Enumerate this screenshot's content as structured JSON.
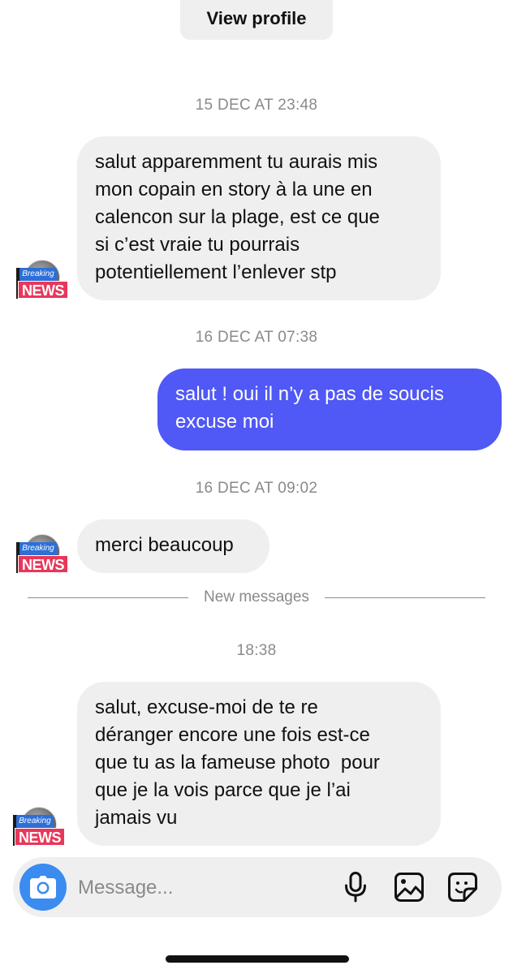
{
  "header": {
    "view_profile_label": "View profile"
  },
  "thread": {
    "timestamps": [
      "15 DEC AT 23:48",
      "16 DEC AT 07:38",
      "16 DEC AT 09:02",
      "18:38"
    ],
    "messages": [
      {
        "direction": "incoming",
        "lines": [
          "salut apparemment tu aurais mis",
          "mon copain en story à la une en",
          "calencon sur la plage, est ce que",
          "si c’est vraie tu pourrais",
          "potentiellement l’enlever stp"
        ]
      },
      {
        "direction": "outgoing",
        "lines": [
          "salut ! oui il n’y a pas de soucis",
          "excuse moi"
        ]
      },
      {
        "direction": "incoming",
        "lines": [
          "merci beaucoup"
        ]
      },
      {
        "direction": "incoming",
        "lines": [
          "salut, excuse-moi de te re",
          "déranger encore une fois est-ce",
          "que tu as la fameuse photo  pour",
          "que je la vois parce que je l’ai",
          "jamais vu"
        ]
      }
    ],
    "new_messages_divider": "New messages"
  },
  "avatar": {
    "badge_top": "Breaking",
    "badge_bottom": "NEWS"
  },
  "composer": {
    "placeholder": "Message...",
    "icons": [
      "camera-icon",
      "microphone-icon",
      "gallery-icon",
      "sticker-icon"
    ]
  },
  "colors": {
    "incoming_bubble": "#efefef",
    "outgoing_bubble": "#5058f5",
    "camera_button": "#3a8cf0",
    "timestamp_text": "#8a8a8a"
  }
}
